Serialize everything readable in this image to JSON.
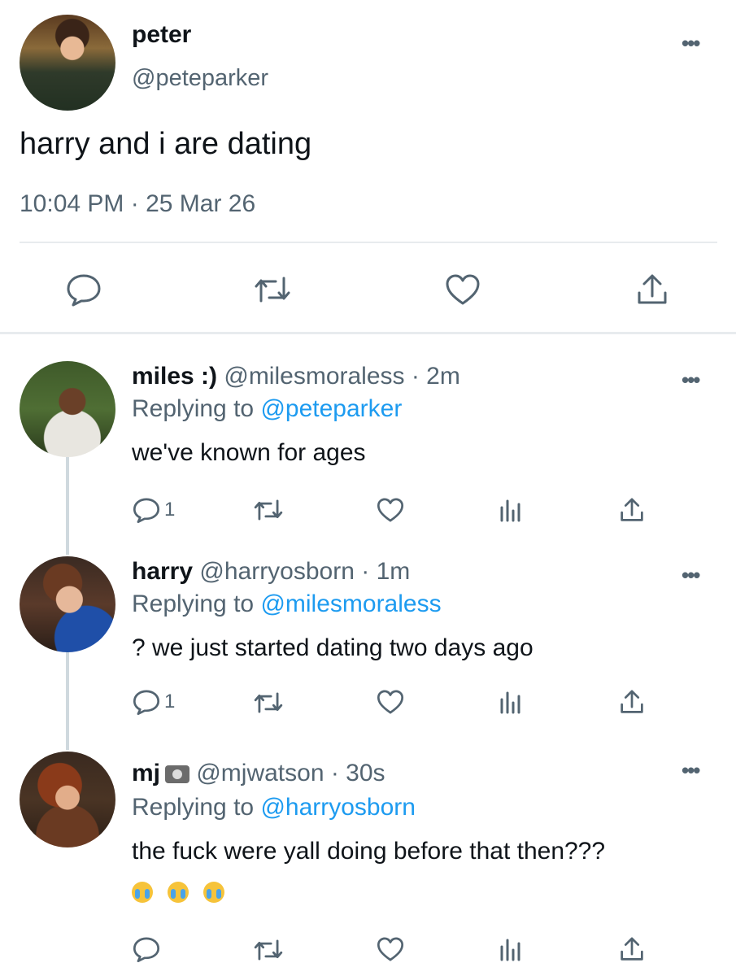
{
  "main_tweet": {
    "name": "peter",
    "handle": "@peteparker",
    "text": "harry and i are dating",
    "timestamp": "10:04 PM · 25 Mar 26",
    "more_label": "•••"
  },
  "replies": [
    {
      "name": "miles :)",
      "handle_time": " @milesmoraless · 2m",
      "replying_prefix": "Replying to ",
      "replying_to": "@peteparker",
      "text": "we've known for ages",
      "reply_count": "1"
    },
    {
      "name": "harry",
      "handle_time": " @harryosborn · 1m",
      "replying_prefix": "Replying to ",
      "replying_to": "@milesmoraless",
      "text": "? we just started dating two days ago",
      "reply_count": "1"
    },
    {
      "name": "mj",
      "handle_time": " @mjwatson · 30s",
      "replying_prefix": "Replying to ",
      "replying_to": "@harryosborn",
      "text": "the fuck were yall doing before that then???",
      "emojis": [
        "loudly-crying-face",
        "loudly-crying-face",
        "loudly-crying-face"
      ],
      "name_emoji": "camera-with-flash"
    }
  ],
  "colors": {
    "link": "#1d9bf0",
    "muted": "#536471",
    "text": "#0f1419"
  }
}
